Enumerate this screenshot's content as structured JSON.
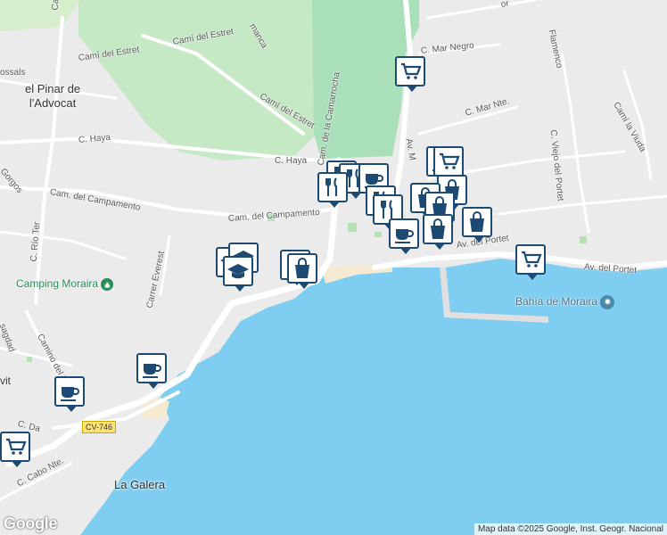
{
  "colors": {
    "land": "#ebebeb",
    "park": "#c5e8c5",
    "park_light": "#d6eecb",
    "water": "#7fcdf0",
    "road": "#ffffff",
    "sand": "#f3ead1",
    "marker_border": "#1d4a73",
    "marker_icon": "#1d4a73"
  },
  "streets": [
    {
      "name": "Camí del Estret",
      "id": "cami-del-estret-1"
    },
    {
      "name": "Camí del Estret",
      "id": "cami-del-estret-2"
    },
    {
      "name": "Camí del Estret",
      "id": "cami-del-estret-3"
    },
    {
      "name": "Cam. de la Camarrocha",
      "id": "cam-camarrocha"
    },
    {
      "name": "C. Haya",
      "id": "c-haya-1"
    },
    {
      "name": "C. Haya",
      "id": "c-haya-2"
    },
    {
      "name": "Cam. del Campamento",
      "id": "cam-campamento-1"
    },
    {
      "name": "Cam. del Campamento",
      "id": "cam-campamento-2"
    },
    {
      "name": "Carrer Everest",
      "id": "carrer-everest"
    },
    {
      "name": "Camino del Dragó",
      "id": "camino-drago"
    },
    {
      "name": "C. Río Ter",
      "id": "c-rio-ter"
    },
    {
      "name": "C. Mar Negro",
      "id": "c-mar-negro"
    },
    {
      "name": "C. Mar Nte.",
      "id": "c-mar-nte"
    },
    {
      "name": "Av. M",
      "id": "av-m"
    },
    {
      "name": "Av. del Portet",
      "id": "av-del-portet-1"
    },
    {
      "name": "Av. del Portet",
      "id": "av-del-portet-2"
    },
    {
      "name": "C. Viejo del Portet",
      "id": "c-viejo-portet"
    },
    {
      "name": "Camí la Viuda",
      "id": "cami-la-viuda"
    },
    {
      "name": "Flamenco",
      "id": "flamenco"
    },
    {
      "name": "C. Cabo Nte.",
      "id": "c-cabo-nte"
    },
    {
      "name": "Gorgos",
      "id": "gorgos"
    },
    {
      "name": "ossals",
      "id": "ossals"
    },
    {
      "name": "manca",
      "id": "manca"
    },
    {
      "name": "sagdad",
      "id": "sagdad"
    },
    {
      "name": "C. Da",
      "id": "c-da"
    },
    {
      "name": "vit",
      "id": "vit"
    },
    {
      "name": "or",
      "id": "or"
    },
    {
      "name": "Camí",
      "id": "cami-top"
    }
  ],
  "places": [
    {
      "name": "el Pinar de\nl'Advocat",
      "id": "el-pinar"
    },
    {
      "name": "La Galera",
      "id": "la-galera"
    }
  ],
  "pois": [
    {
      "name": "Camping Moraira",
      "icon": "tent-icon"
    },
    {
      "name": "Bahía de Moraira",
      "icon": "pin-icon"
    }
  ],
  "road_shield": "CV-746",
  "markers": [
    {
      "type": "shopping-cart"
    },
    {
      "type": "restaurant"
    },
    {
      "type": "restaurant"
    },
    {
      "type": "cafe"
    },
    {
      "type": "restaurant"
    },
    {
      "type": "cafe"
    },
    {
      "type": "shopping-cart"
    },
    {
      "type": "shopping-bag"
    },
    {
      "type": "restaurant"
    },
    {
      "type": "restaurant"
    },
    {
      "type": "shopping-bag"
    },
    {
      "type": "shopping-bag"
    },
    {
      "type": "cafe"
    },
    {
      "type": "shopping-bag"
    },
    {
      "type": "shopping-bag"
    },
    {
      "type": "school"
    },
    {
      "type": "school"
    },
    {
      "type": "school"
    },
    {
      "type": "shopping-bag"
    },
    {
      "type": "shopping-bag"
    },
    {
      "type": "cafe"
    },
    {
      "type": "cafe"
    },
    {
      "type": "shopping-cart"
    },
    {
      "type": "shopping-cart"
    }
  ],
  "attribution": "Map data ©2025 Google, Inst. Geogr. Nacional",
  "logo": "Google"
}
